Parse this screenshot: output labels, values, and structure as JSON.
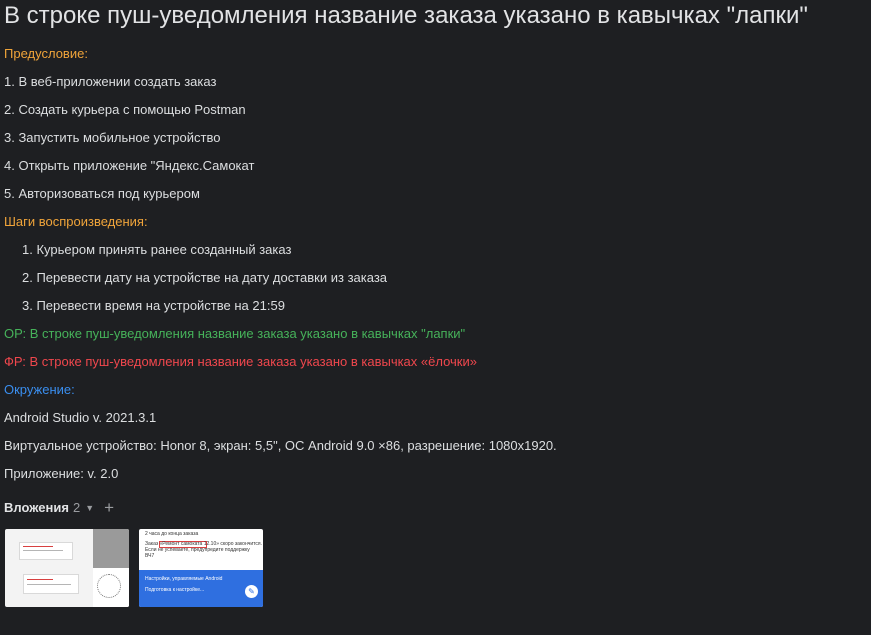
{
  "title": "В строке пуш-уведомления название заказа указано в кавычках \"лапки\"",
  "precondition": {
    "heading": "Предусловие:",
    "items": [
      "1. В веб-приложении создать заказ",
      "2. Создать курьера с помощью Postman",
      "3. Запустить мобильное устройство",
      "4. Открыть приложение \"Яндекс.Самокат",
      "5. Авторизоваться под курьером"
    ]
  },
  "steps": {
    "heading": "Шаги воспроизведения:",
    "items": [
      "1. Курьером принять ранее созданный заказ",
      "2. Перевести дату на устройстве на дату доставки из заказа",
      "3. Перевести время на устройстве на 21:59"
    ]
  },
  "expected": "ОР: В строке пуш-уведомления название заказа указано в кавычках \"лапки\"",
  "actual": "ФР: В строке пуш-уведомления название заказа указано в кавычках «ёлочки»",
  "environment": {
    "heading": "Окружение:",
    "items": [
      "Android Studio v. 2021.3.1",
      "Виртуальное устройство: Honor 8, экран: 5,5\", ОС Android 9.0 ×86, разрешение: 1080x1920.",
      "Приложение: v. 2.0"
    ]
  },
  "attachments": {
    "title": "Вложения",
    "count": "2",
    "caret_icon": "chevron-down-icon",
    "add_icon": "plus-icon",
    "thumb2": {
      "line1": "2 часа до конца заказа",
      "line2": "Заказ «Ремонт самоката 12.10» скоро закончится.",
      "line3": "Если не успеваете, предупредите поддержку",
      "line4": "ВЧ7",
      "blue_line1": "Настройки, управляемые Android",
      "blue_line2": "Подготовка к настройке..."
    }
  },
  "colors": {
    "background": "#1e1f22",
    "text": "#dcdee0",
    "orange": "#f0a43a",
    "green": "#46b25a",
    "red": "#f0474d",
    "blue": "#3a8eef"
  }
}
